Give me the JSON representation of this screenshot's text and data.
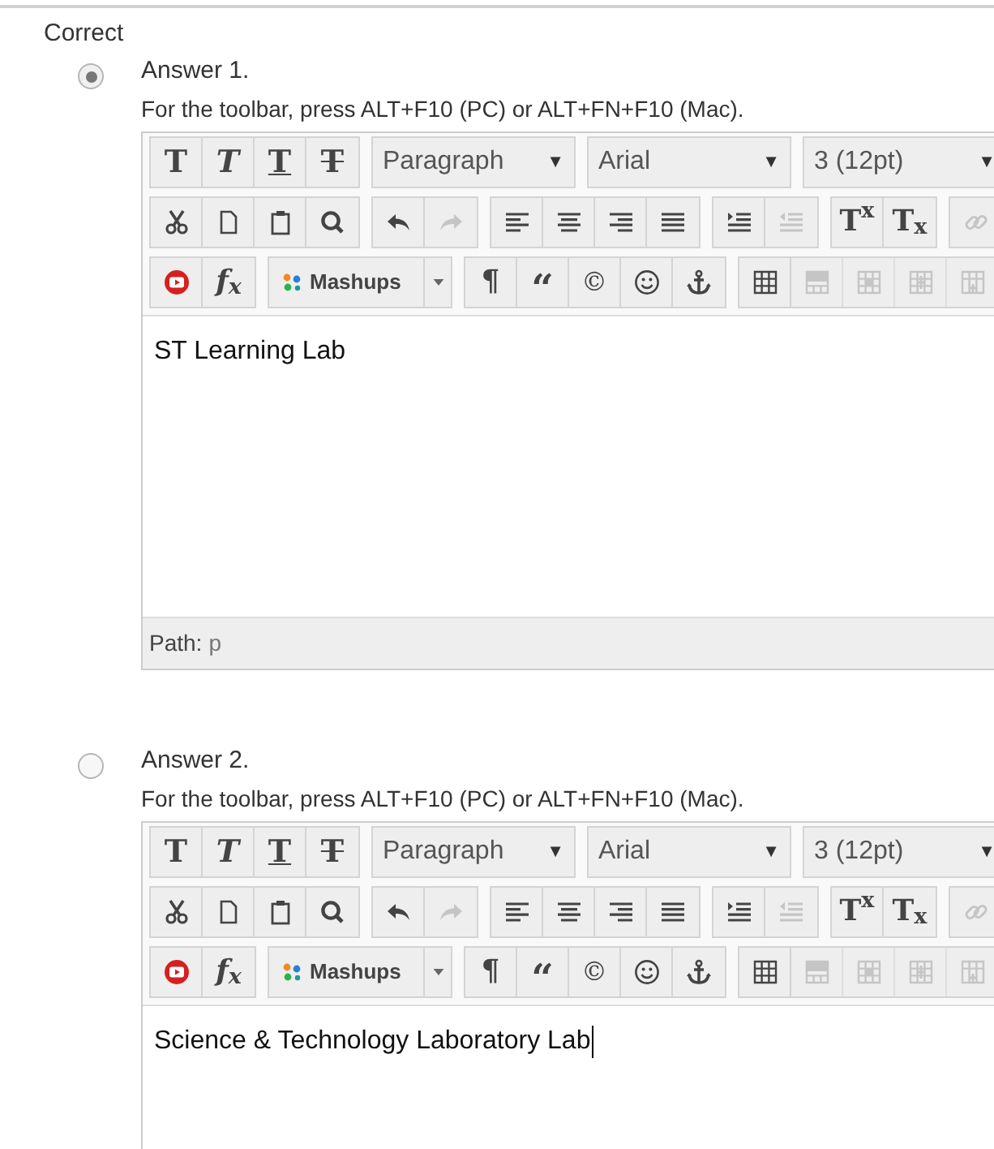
{
  "heading": "Correct",
  "answers": [
    {
      "label": "Answer 1.",
      "selected": true,
      "hint": "For the toolbar, press ALT+F10 (PC) or ALT+FN+F10 (Mac).",
      "toolbar": [
        [
          [
            {
              "text": "T",
              "disabled": false
            },
            {
              "text": "T",
              "disabled": false
            },
            {
              "text": "T",
              "disabled": false
            },
            {
              "text": "T",
              "disabled": false
            }
          ],
          [
            {
              "text": "Paragraph",
              "arrow": "▼",
              "disabled": false
            }
          ],
          [
            {
              "text": "Arial",
              "arrow": "▼",
              "disabled": false
            }
          ],
          [
            {
              "text": "3 (12pt)",
              "arrow": "▼",
              "disabled": false
            }
          ]
        ],
        [
          [
            {
              "disabled": false
            },
            {
              "disabled": false
            },
            {
              "disabled": false
            },
            {
              "disabled": false
            }
          ],
          [
            {
              "disabled": false
            },
            {
              "disabled": true
            }
          ],
          [
            {
              "disabled": false
            },
            {
              "disabled": false
            },
            {
              "disabled": false
            },
            {
              "disabled": false
            }
          ],
          [
            {
              "disabled": false
            },
            {
              "disabled": true
            }
          ],
          [
            {
              "text": "T$^{x}$",
              "disabled": false
            },
            {
              "text": "T$_{x}$",
              "disabled": false
            }
          ],
          [
            {
              "disabled": true
            }
          ]
        ],
        [
          [
            {
              "disabled": false
            },
            {
              "text": "f$_{x}$",
              "disabled": false
            }
          ],
          [
            {
              "text": "Mashups",
              "disabled": false
            }
          ],
          [
            {
              "text": "¶",
              "disabled": false
            },
            {
              "text": "“",
              "disabled": false
            },
            {
              "text": "©",
              "disabled": false
            },
            {
              "disabled": false
            },
            {
              "disabled": false
            }
          ],
          [
            {
              "disabled": false
            },
            {
              "disabled": true
            },
            {
              "disabled": true
            },
            {
              "disabled": true
            },
            {
              "disabled": true
            }
          ]
        ]
      ],
      "content": "ST Learning Lab",
      "focused": false,
      "path_label": "Path:",
      "path_value": "p"
    },
    {
      "label": "Answer 2.",
      "selected": false,
      "hint": "For the toolbar, press ALT+F10 (PC) or ALT+FN+F10 (Mac).",
      "toolbar": [
        [
          [
            {
              "text": "T",
              "disabled": false
            },
            {
              "text": "T",
              "disabled": false
            },
            {
              "text": "T",
              "disabled": false
            },
            {
              "text": "T",
              "disabled": false
            }
          ],
          [
            {
              "text": "Paragraph",
              "arrow": "▼",
              "disabled": false
            }
          ],
          [
            {
              "text": "Arial",
              "arrow": "▼",
              "disabled": false
            }
          ],
          [
            {
              "text": "3 (12pt)",
              "arrow": "▼",
              "disabled": false
            }
          ]
        ],
        [
          [
            {
              "disabled": false
            },
            {
              "disabled": false
            },
            {
              "disabled": false
            },
            {
              "disabled": false
            }
          ],
          [
            {
              "disabled": false
            },
            {
              "disabled": true
            }
          ],
          [
            {
              "disabled": false
            },
            {
              "disabled": false
            },
            {
              "disabled": false
            },
            {
              "disabled": false
            }
          ],
          [
            {
              "disabled": false
            },
            {
              "disabled": true
            }
          ],
          [
            {
              "text": "T$^{x}$",
              "disabled": false
            },
            {
              "text": "T$_{x}$",
              "disabled": false
            }
          ],
          [
            {
              "disabled": true
            }
          ]
        ],
        [
          [
            {
              "disabled": false
            },
            {
              "text": "f$_{x}$",
              "disabled": false
            }
          ],
          [
            {
              "text": "Mashups",
              "disabled": false
            }
          ],
          [
            {
              "text": "¶",
              "disabled": false
            },
            {
              "text": "“",
              "disabled": false
            },
            {
              "text": "©",
              "disabled": false
            },
            {
              "disabled": false
            },
            {
              "disabled": false
            }
          ],
          [
            {
              "disabled": false
            },
            {
              "disabled": true
            },
            {
              "disabled": true
            },
            {
              "disabled": true
            },
            {
              "disabled": true
            }
          ]
        ]
      ],
      "content": "Science & Technology Laboratory Lab",
      "focused": true
    }
  ]
}
